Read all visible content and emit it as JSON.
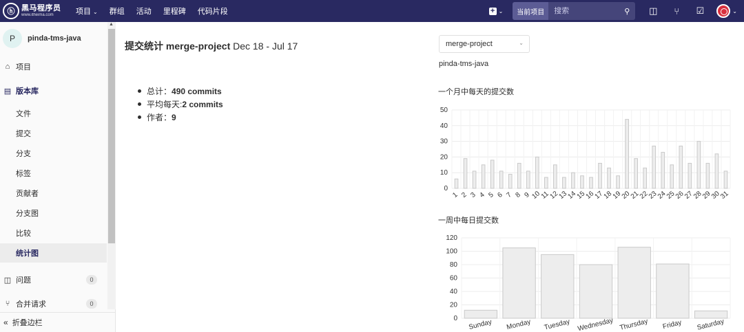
{
  "topnav": {
    "logo_cn": "黑马程序员",
    "logo_url": "www.itheima.com",
    "items": [
      "项目",
      "群组",
      "活动",
      "里程碑",
      "代码片段"
    ],
    "search_scope": "当前项目",
    "search_placeholder": "搜索",
    "bg_color": "#292961"
  },
  "sidebar": {
    "project_initial": "P",
    "project_name": "pinda-tms-java",
    "project": "项目",
    "repository": "版本库",
    "sub_items": [
      "文件",
      "提交",
      "分支",
      "标签",
      "贡献者",
      "分支图",
      "比较",
      "统计图"
    ],
    "active_sub": "统计图",
    "issues": "问题",
    "issues_count": "0",
    "merge_requests": "合并请求",
    "merge_requests_count": "0",
    "collapse": "折叠边栏"
  },
  "main": {
    "title_bold": "提交统计 merge-project",
    "title_range": "Dec 18 - Jul 17",
    "stats": [
      {
        "label": "总计：",
        "value": "490 commits"
      },
      {
        "label": "平均每天: ",
        "value": "2 commits"
      },
      {
        "label": "作者：",
        "value": "9"
      }
    ]
  },
  "right": {
    "ref_select": "merge-project",
    "repo_name": "pinda-tms-java",
    "month_chart_title": "一个月中每天的提交数",
    "week_chart_title": "一周中每日提交数"
  },
  "chart_data": [
    {
      "type": "bar",
      "x": [
        1,
        2,
        3,
        4,
        5,
        6,
        7,
        8,
        9,
        10,
        11,
        12,
        13,
        14,
        15,
        16,
        17,
        18,
        19,
        20,
        21,
        22,
        23,
        24,
        25,
        26,
        27,
        28,
        29,
        30,
        31
      ],
      "values": [
        6,
        19,
        11,
        15,
        18,
        11,
        9,
        16,
        11,
        20,
        7,
        15,
        7,
        10,
        8,
        7,
        16,
        13,
        8,
        44,
        19,
        13,
        27,
        23,
        15,
        27,
        16,
        30,
        16,
        22,
        11
      ],
      "yticks": [
        0,
        10,
        20,
        30,
        40,
        50
      ],
      "ylim": [
        0,
        50
      ],
      "grid": true,
      "bar_color": "#ededed",
      "bar_stroke": "#c9c9c9"
    },
    {
      "type": "bar",
      "categories": [
        "Sunday",
        "Monday",
        "Tuesday",
        "Wednesday",
        "Thursday",
        "Friday",
        "Saturday"
      ],
      "values": [
        12,
        105,
        95,
        80,
        106,
        81,
        11
      ],
      "yticks": [
        0,
        20,
        40,
        60,
        80,
        100,
        120
      ],
      "ylim": [
        0,
        120
      ],
      "grid": true,
      "bar_color": "#ededed",
      "bar_stroke": "#c9c9c9"
    }
  ]
}
